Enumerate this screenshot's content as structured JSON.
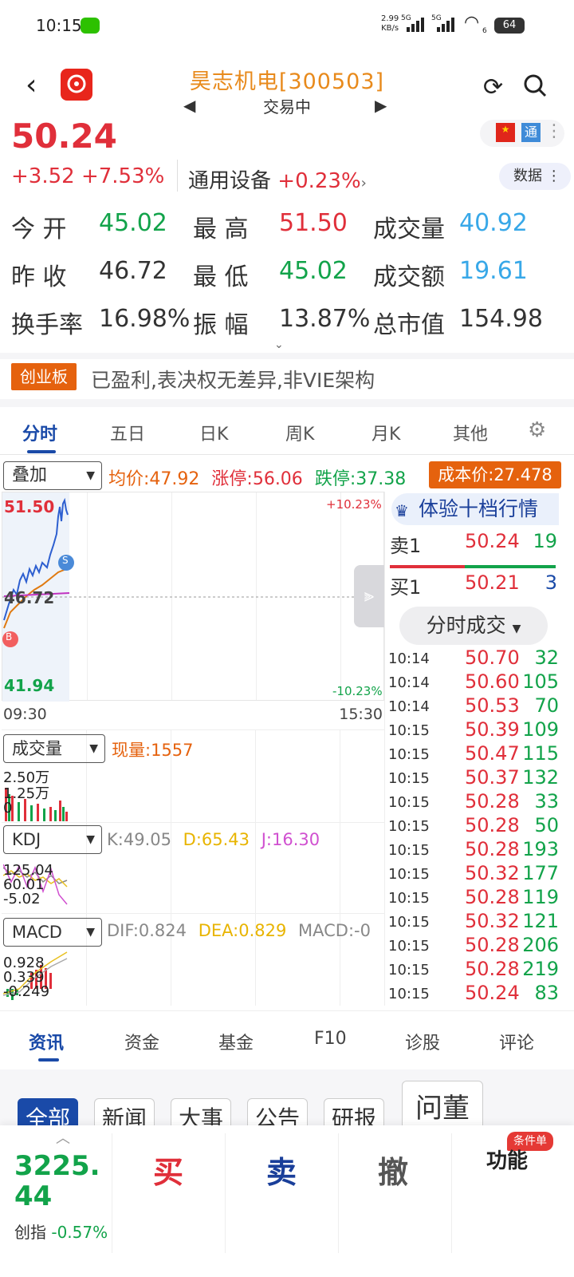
{
  "status_bar": {
    "time": "10:15",
    "net_speed_value": "2.99",
    "net_speed_unit": "KB/s",
    "sig1": "5G",
    "sig2": "5G",
    "wifi_sub": "6",
    "battery": "64"
  },
  "header": {
    "title": "昊志机电[300503]",
    "subtitle": "交易中"
  },
  "quote": {
    "price": "50.24",
    "change": "+3.52",
    "change_pct": "+7.53%",
    "sector_name": "通用设备",
    "sector_pct": "+0.23%",
    "sector_arrow": "›",
    "tong": "通",
    "data_btn": "数据"
  },
  "stats": {
    "open_label": "今 开",
    "open": "45.02",
    "high_label": "最 高",
    "high": "51.50",
    "vol_label": "成交量",
    "vol": "40.92",
    "prev_label": "昨 收",
    "prev": "46.72",
    "low_label": "最 低",
    "low": "45.02",
    "amt_label": "成交额",
    "amt": "19.61",
    "turn_label": "换手率",
    "turn": "16.98%",
    "amp_label": "振 幅",
    "amp": "13.87%",
    "mcap_label": "总市值",
    "mcap": "154.98"
  },
  "tags": {
    "board": "创业板",
    "text": "已盈利,表决权无差异,非VIE架构"
  },
  "period_tabs": [
    "分时",
    "五日",
    "日K",
    "周K",
    "月K",
    "其他"
  ],
  "overlay": {
    "label": "叠加",
    "avg": "均价:47.92",
    "limit_up": "涨停:56.06",
    "limit_down": "跌停:37.38",
    "cost": "成本价:27.478"
  },
  "intraday": {
    "y_high": "51.50",
    "y_mid": "46.72",
    "y_low": "41.94",
    "pct_high": "+10.23%",
    "pct_low": "-10.23%",
    "t_start": "09:30",
    "t_end": "15:30",
    "b_mark": "B",
    "s_mark": "S"
  },
  "volume": {
    "label": "成交量",
    "now": "现量:1557",
    "l1": "2.50万",
    "l2": "1.25万",
    "l3": "0"
  },
  "kdj": {
    "label": "KDJ",
    "k": "K:49.05",
    "d": "D:65.43",
    "j": "J:16.30",
    "l1": "125.04",
    "l2": "60.01",
    "l3": "-5.02"
  },
  "macd": {
    "label": "MACD",
    "dif": "DIF:0.824",
    "dea": "DEA:0.829",
    "macd": "MACD:-0",
    "l1": "0.928",
    "l2": "0.339",
    "l3": "-0.249"
  },
  "level2": {
    "title": "体验十档行情",
    "sell_label": "卖1",
    "sell_price": "50.24",
    "sell_vol": "19",
    "buy_label": "买1",
    "buy_price": "50.21",
    "buy_vol": "3",
    "ticks_btn": "分时成交"
  },
  "ticks": [
    {
      "t": "10:14",
      "p": "50.70",
      "v": "32"
    },
    {
      "t": "10:14",
      "p": "50.60",
      "v": "105"
    },
    {
      "t": "10:14",
      "p": "50.53",
      "v": "70"
    },
    {
      "t": "10:15",
      "p": "50.39",
      "v": "109"
    },
    {
      "t": "10:15",
      "p": "50.47",
      "v": "115"
    },
    {
      "t": "10:15",
      "p": "50.37",
      "v": "132"
    },
    {
      "t": "10:15",
      "p": "50.28",
      "v": "33"
    },
    {
      "t": "10:15",
      "p": "50.28",
      "v": "50"
    },
    {
      "t": "10:15",
      "p": "50.28",
      "v": "193"
    },
    {
      "t": "10:15",
      "p": "50.32",
      "v": "177"
    },
    {
      "t": "10:15",
      "p": "50.28",
      "v": "119"
    },
    {
      "t": "10:15",
      "p": "50.32",
      "v": "121"
    },
    {
      "t": "10:15",
      "p": "50.28",
      "v": "206"
    },
    {
      "t": "10:15",
      "p": "50.28",
      "v": "219"
    },
    {
      "t": "10:15",
      "p": "50.24",
      "v": "83"
    }
  ],
  "bottom_tabs": [
    "资讯",
    "资金",
    "基金",
    "F10",
    "诊股",
    "评论"
  ],
  "news_chips": [
    "全部",
    "新闻",
    "大事",
    "公告",
    "研报"
  ],
  "wendong": "问董",
  "bottom_bar": {
    "index_value": "3225.44",
    "index_name": "创指",
    "index_pct": "-0.57%",
    "buy": "买",
    "sell": "卖",
    "cancel": "撤",
    "func": "功能",
    "cond": "条件单"
  },
  "colors": {
    "up": "#e02f3a",
    "down": "#12a34a",
    "accent": "#1a4aa8",
    "title": "#e88a1c",
    "vol": "#38a8e8"
  }
}
